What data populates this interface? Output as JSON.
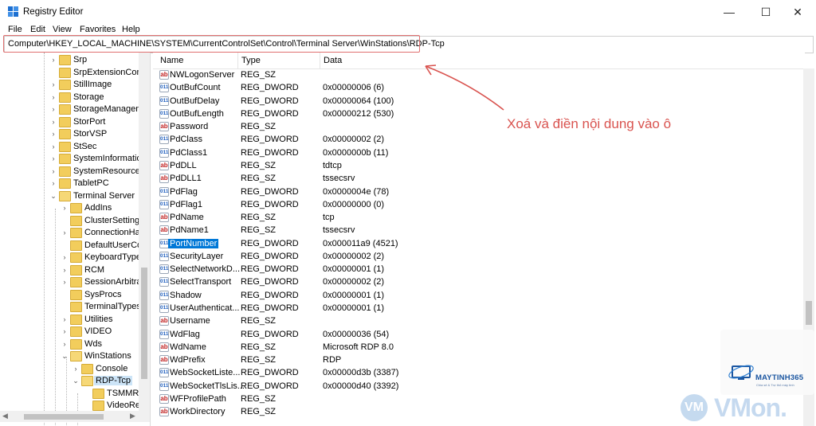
{
  "window": {
    "title": "Registry Editor",
    "minimize": "—",
    "maximize": "☐",
    "close": "✕"
  },
  "menu": [
    "File",
    "Edit",
    "View",
    "Favorites",
    "Help"
  ],
  "address": "Computer\\HKEY_LOCAL_MACHINE\\SYSTEM\\CurrentControlSet\\Control\\Terminal Server\\WinStations\\RDP-Tcp",
  "tree": {
    "items": [
      {
        "label": "Srp",
        "expandable": true
      },
      {
        "label": "SrpExtensionConfi",
        "expandable": false
      },
      {
        "label": "StillImage",
        "expandable": true
      },
      {
        "label": "Storage",
        "expandable": true
      },
      {
        "label": "StorageManageme",
        "expandable": true
      },
      {
        "label": "StorPort",
        "expandable": true
      },
      {
        "label": "StorVSP",
        "expandable": true
      },
      {
        "label": "StSec",
        "expandable": true
      },
      {
        "label": "SystemInformation",
        "expandable": true
      },
      {
        "label": "SystemResources",
        "expandable": true
      },
      {
        "label": "TabletPC",
        "expandable": true
      },
      {
        "label": "Terminal Server",
        "expandable": true,
        "expanded": true
      },
      {
        "label": "AddIns",
        "expandable": true
      },
      {
        "label": "ClusterSettings",
        "expandable": false
      },
      {
        "label": "ConnectionHar",
        "expandable": true
      },
      {
        "label": "DefaultUserCon",
        "expandable": false
      },
      {
        "label": "KeyboardType N",
        "expandable": true
      },
      {
        "label": "RCM",
        "expandable": true
      },
      {
        "label": "SessionArbitrati",
        "expandable": true
      },
      {
        "label": "SysProcs",
        "expandable": false
      },
      {
        "label": "TerminalTypes",
        "expandable": false
      },
      {
        "label": "Utilities",
        "expandable": true
      },
      {
        "label": "VIDEO",
        "expandable": true
      },
      {
        "label": "Wds",
        "expandable": true
      },
      {
        "label": "WinStations",
        "expandable": true,
        "expanded": true
      },
      {
        "label": "Console",
        "expandable": true
      },
      {
        "label": "RDP-Tcp",
        "expandable": true,
        "expanded": true,
        "selected": true
      },
      {
        "label": "TSMMRer",
        "expandable": false
      },
      {
        "label": "VideoRen",
        "expandable": false
      }
    ]
  },
  "columns": {
    "name": "Name",
    "type": "Type",
    "data": "Data"
  },
  "values": [
    {
      "name": "NWLogonServer",
      "type": "REG_SZ",
      "data": "",
      "icon": "ab"
    },
    {
      "name": "OutBufCount",
      "type": "REG_DWORD",
      "data": "0x00000006 (6)",
      "icon": "bin"
    },
    {
      "name": "OutBufDelay",
      "type": "REG_DWORD",
      "data": "0x00000064 (100)",
      "icon": "bin"
    },
    {
      "name": "OutBufLength",
      "type": "REG_DWORD",
      "data": "0x00000212 (530)",
      "icon": "bin"
    },
    {
      "name": "Password",
      "type": "REG_SZ",
      "data": "",
      "icon": "ab"
    },
    {
      "name": "PdClass",
      "type": "REG_DWORD",
      "data": "0x00000002 (2)",
      "icon": "bin"
    },
    {
      "name": "PdClass1",
      "type": "REG_DWORD",
      "data": "0x0000000b (11)",
      "icon": "bin"
    },
    {
      "name": "PdDLL",
      "type": "REG_SZ",
      "data": "tdtcp",
      "icon": "ab"
    },
    {
      "name": "PdDLL1",
      "type": "REG_SZ",
      "data": "tssecsrv",
      "icon": "ab"
    },
    {
      "name": "PdFlag",
      "type": "REG_DWORD",
      "data": "0x0000004e (78)",
      "icon": "bin"
    },
    {
      "name": "PdFlag1",
      "type": "REG_DWORD",
      "data": "0x00000000 (0)",
      "icon": "bin"
    },
    {
      "name": "PdName",
      "type": "REG_SZ",
      "data": "tcp",
      "icon": "ab"
    },
    {
      "name": "PdName1",
      "type": "REG_SZ",
      "data": "tssecsrv",
      "icon": "ab"
    },
    {
      "name": "PortNumber",
      "type": "REG_DWORD",
      "data": "0x000011a9 (4521)",
      "icon": "bin",
      "selected": true
    },
    {
      "name": "SecurityLayer",
      "type": "REG_DWORD",
      "data": "0x00000002 (2)",
      "icon": "bin"
    },
    {
      "name": "SelectNetworkD...",
      "type": "REG_DWORD",
      "data": "0x00000001 (1)",
      "icon": "bin"
    },
    {
      "name": "SelectTransport",
      "type": "REG_DWORD",
      "data": "0x00000002 (2)",
      "icon": "bin"
    },
    {
      "name": "Shadow",
      "type": "REG_DWORD",
      "data": "0x00000001 (1)",
      "icon": "bin"
    },
    {
      "name": "UserAuthenticat...",
      "type": "REG_DWORD",
      "data": "0x00000001 (1)",
      "icon": "bin"
    },
    {
      "name": "Username",
      "type": "REG_SZ",
      "data": "",
      "icon": "ab"
    },
    {
      "name": "WdFlag",
      "type": "REG_DWORD",
      "data": "0x00000036 (54)",
      "icon": "bin"
    },
    {
      "name": "WdName",
      "type": "REG_SZ",
      "data": "Microsoft RDP 8.0",
      "icon": "ab"
    },
    {
      "name": "WdPrefix",
      "type": "REG_SZ",
      "data": "RDP",
      "icon": "ab"
    },
    {
      "name": "WebSocketListe...",
      "type": "REG_DWORD",
      "data": "0x00000d3b (3387)",
      "icon": "bin"
    },
    {
      "name": "WebSocketTlsLis...",
      "type": "REG_DWORD",
      "data": "0x00000d40 (3392)",
      "icon": "bin"
    },
    {
      "name": "WFProfilePath",
      "type": "REG_SZ",
      "data": "",
      "icon": "ab"
    },
    {
      "name": "WorkDirectory",
      "type": "REG_SZ",
      "data": "",
      "icon": "ab"
    }
  ],
  "icon_text": {
    "ab": "ab",
    "bin": "011"
  },
  "annotation": "Xoá và điền nội dung vào ô",
  "watermark": {
    "brand": "MAYTINH365",
    "tagline": "Chia sẻ & Trợ thủ máy tính",
    "vm": "VM",
    "vmon": "VMon."
  },
  "colors": {
    "selection": "#0078d7",
    "annotation": "#d9534f",
    "folder": "#f2cd5c"
  }
}
